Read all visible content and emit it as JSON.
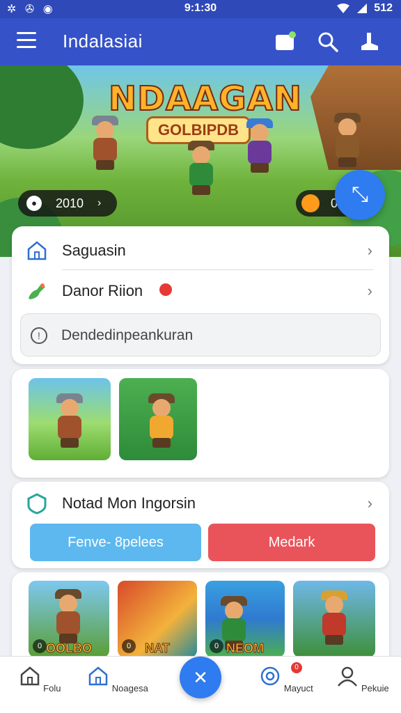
{
  "status_bar": {
    "left_icons": "✲ ✇ ◉",
    "time": "9:1:30",
    "battery": "512"
  },
  "app_bar": {
    "title": "Indalasiai"
  },
  "hero": {
    "banner_title": "NDAAGAN",
    "banner_subtitle": "GOLBIPDB",
    "score_pill": "2010",
    "coins_pill": "0"
  },
  "menu_card": {
    "item1_label": "Saguasin",
    "item2_label": "Danor Riion",
    "search_placeholder": "Dendedinpeankuran"
  },
  "promo_card": {
    "title": "Notad Mon Ingorsin",
    "btn_left": "Fenve- 8pelees",
    "btn_right": "Medark"
  },
  "game_strip": [
    {
      "label": "OOLBO",
      "badge": "0"
    },
    {
      "label": "NAT",
      "badge": "0"
    },
    {
      "label": "NEOM",
      "badge": "0"
    },
    {
      "label": "",
      "badge": ""
    }
  ],
  "bottom_nav": {
    "items": [
      {
        "label": "Folu",
        "icon": "home-icon"
      },
      {
        "label": "Noagesa",
        "icon": "home-icon"
      },
      {
        "label": "",
        "icon": "close-icon"
      },
      {
        "label": "Mayuct",
        "icon": "target-icon"
      },
      {
        "label": "Pekuie",
        "icon": "person-icon"
      }
    ],
    "notif_badge": "0"
  },
  "colors": {
    "primary": "#3552c8",
    "accent_blue": "#2f7bf0",
    "light_blue": "#5cb8ee",
    "red": "#e9545a"
  }
}
